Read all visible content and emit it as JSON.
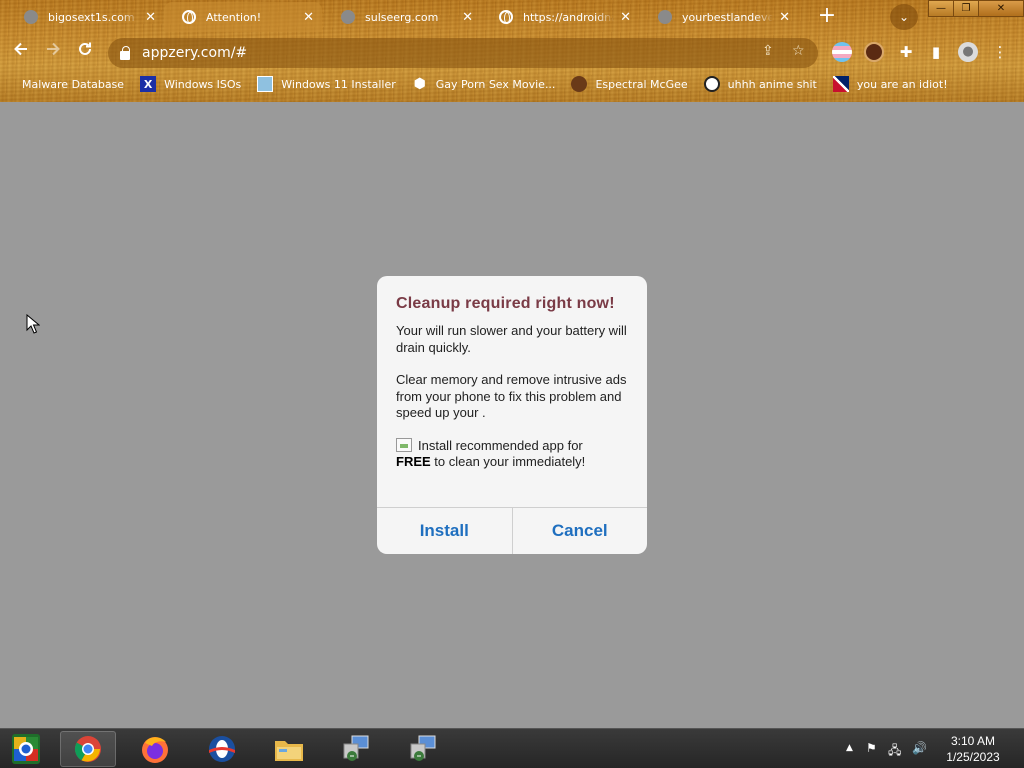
{
  "browser": {
    "tabs": [
      {
        "title": "bigosext1s.com",
        "icon": "gray-circle-icon",
        "active": false
      },
      {
        "title": "Attention!",
        "icon": "globe-icon",
        "active": true
      },
      {
        "title": "sulseerg.com",
        "icon": "gray-circle-icon",
        "active": false
      },
      {
        "title": "https://androidna",
        "icon": "globe-icon",
        "active": false
      },
      {
        "title": "yourbestlandever",
        "icon": "gray-circle-icon",
        "active": false
      }
    ],
    "close_glyph": "✕",
    "new_tab_glyph": "+",
    "tab_search_glyph": "⌄",
    "url": "appzery.com/#",
    "window_controls": {
      "minimize": "—",
      "restore": "❐",
      "close": "✕"
    }
  },
  "bookmarks": [
    {
      "label": "Malware Database",
      "icon": "blank"
    },
    {
      "label": "Windows ISOs",
      "icon": "x-icon"
    },
    {
      "label": "Windows 11 Installer",
      "icon": "picture-icon"
    },
    {
      "label": "Gay Porn Sex Movie...",
      "icon": "cube-icon"
    },
    {
      "label": "Espectral McGee",
      "icon": "character-icon"
    },
    {
      "label": "uhhh anime shit",
      "icon": "anime-icon"
    },
    {
      "label": "you are an idiot!",
      "icon": "uk-flag-icon"
    }
  ],
  "dialog": {
    "title": "Cleanup required right now!",
    "para1": "Your will run slower and your battery will drain quickly.",
    "para2": "Clear memory and remove intrusive ads from your phone to fix this problem and speed up your .",
    "install_text_1": "Install recommended app for",
    "install_free": "FREE",
    "install_text_2": " to clean your immediately!",
    "install_button": "Install",
    "cancel_button": "Cancel",
    "title_color": "#7a3b46",
    "button_color": "#1f6fbf"
  },
  "taskbar": {
    "time": "3:10 AM",
    "date": "1/25/2023",
    "apps": [
      "start-icon",
      "chrome-icon",
      "firefox-icon",
      "opera-icon",
      "file-explorer-icon",
      "network-setup-icon",
      "network-setup-icon"
    ]
  },
  "colors": {
    "page_background": "#9a9a9a",
    "chrome_theme": "#c98a2c"
  }
}
